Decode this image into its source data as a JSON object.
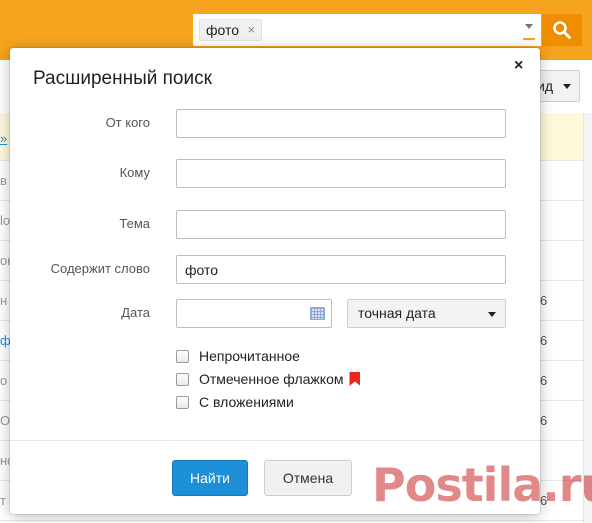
{
  "search": {
    "tag_label": "фото",
    "tag_remove": "×",
    "button_icon": "search-icon"
  },
  "background": {
    "view_button_label": "ид",
    "highlight_cut": "»",
    "rows": [
      {
        "cut": "в",
        "num": ""
      },
      {
        "cut": "lo",
        "num": ""
      },
      {
        "cut": "он",
        "num": ""
      },
      {
        "cut": "н",
        "num": "6"
      },
      {
        "cut": "ф",
        "num": "6"
      },
      {
        "cut": "о",
        "num": "6"
      },
      {
        "cut": "О",
        "num": "6"
      },
      {
        "cut": "но",
        "num": ""
      },
      {
        "cut": "т",
        "num": "6"
      }
    ]
  },
  "dialog": {
    "title": "Расширенный поиск",
    "close_label": "×",
    "fields": {
      "from_label": "От кого",
      "from_value": "",
      "to_label": "Кому",
      "to_value": "",
      "subject_label": "Тема",
      "subject_value": "",
      "contains_label": "Содержит слово",
      "contains_value": "фото",
      "date_label": "Дата",
      "date_value": "",
      "date_mode": "точная дата"
    },
    "checkboxes": {
      "unread": "Непрочитанное",
      "flagged": "Отмеченное флажком",
      "attachments": "С вложениями"
    },
    "buttons": {
      "find": "Найти",
      "cancel": "Отмена"
    }
  },
  "watermark": "Postila.ru",
  "colors": {
    "topbar": "#f6a41e",
    "search_button": "#f08c00",
    "primary_button": "#1c8fd6",
    "flag": "#e8261d"
  }
}
